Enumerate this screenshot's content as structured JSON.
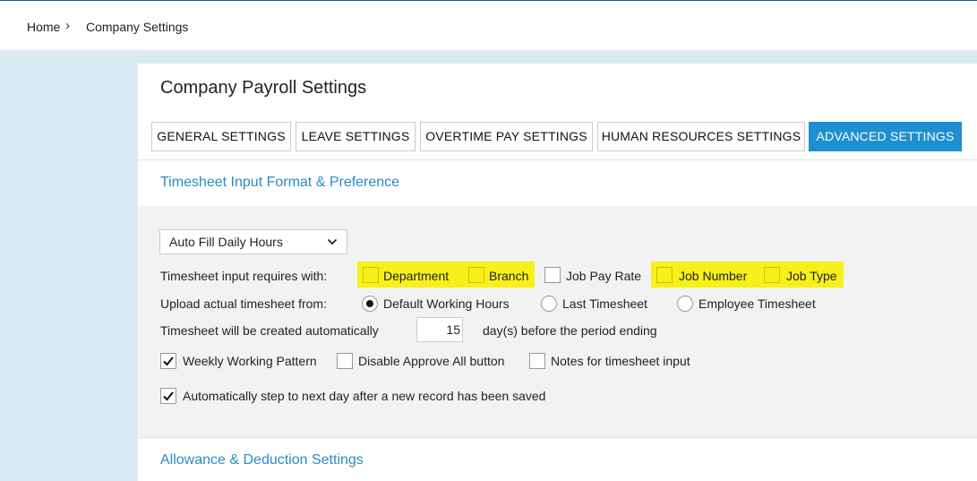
{
  "breadcrumb": {
    "home": "Home",
    "separator": "›",
    "current": "Company Settings"
  },
  "page": {
    "title": "Company Payroll Settings"
  },
  "tabs": [
    {
      "label": "GENERAL SETTINGS"
    },
    {
      "label": "LEAVE SETTINGS"
    },
    {
      "label": "OVERTIME PAY SETTINGS"
    },
    {
      "label": "HUMAN RESOURCES SETTINGS"
    },
    {
      "label": "ADVANCED SETTINGS",
      "active": true
    }
  ],
  "sections": {
    "timesheet_title": "Timesheet Input Format & Preference",
    "allowance_title": "Allowance & Deduction Settings"
  },
  "timesheet": {
    "fill_mode": {
      "selected": "Auto Fill Daily Hours"
    },
    "requires_label": "Timesheet input requires with:",
    "requires_options": [
      {
        "label": "Department",
        "checked": false,
        "highlighted": true
      },
      {
        "label": "Branch",
        "checked": false,
        "highlighted": true
      },
      {
        "label": "Job Pay Rate",
        "checked": false,
        "highlighted": false
      },
      {
        "label": "Job Number",
        "checked": false,
        "highlighted": true
      },
      {
        "label": "Job Type",
        "checked": false,
        "highlighted": true
      }
    ],
    "upload_label": "Upload actual timesheet from:",
    "upload_options": [
      {
        "label": "Default Working Hours",
        "selected": true
      },
      {
        "label": "Last Timesheet",
        "selected": false
      },
      {
        "label": "Employee Timesheet",
        "selected": false
      }
    ],
    "auto_create_label": "Timesheet will be created automatically",
    "auto_create_days": "15",
    "auto_create_suffix": "day(s) before the period ending",
    "checkboxes": [
      {
        "label": "Weekly Working Pattern",
        "checked": true
      },
      {
        "label": "Disable Approve All button",
        "checked": false
      },
      {
        "label": "Notes for timesheet input",
        "checked": false
      }
    ],
    "auto_step": {
      "label": "Automatically step to next day after a new record has been saved",
      "checked": true
    }
  },
  "colors": {
    "accent": "#1e8fd0",
    "section_title": "#2a8cc4",
    "highlight": "#f7f01a",
    "background": "#d9ebf2"
  }
}
